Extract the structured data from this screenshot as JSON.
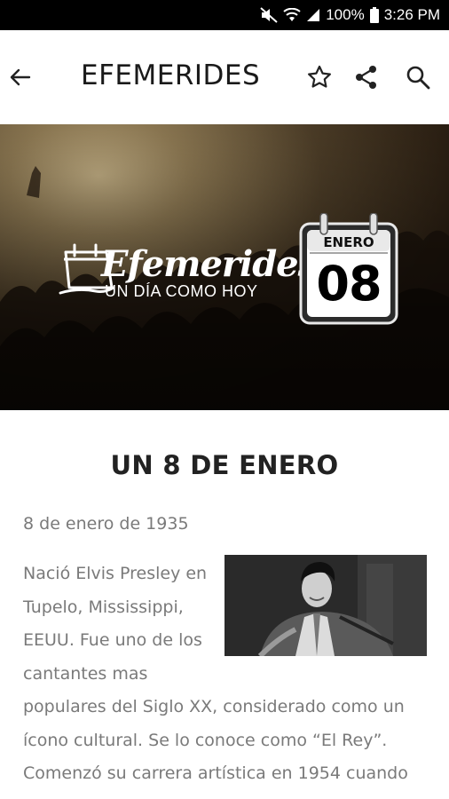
{
  "status_bar": {
    "battery": "100%",
    "time": "3:26 PM"
  },
  "app_bar": {
    "title": "EFEMERIDES",
    "icons": [
      "back-arrow-icon",
      "star-icon",
      "share-icon",
      "search-icon"
    ]
  },
  "banner": {
    "logo_title": "Efemerides",
    "logo_subtitle": "UN DÍA COMO HOY",
    "calendar_month": "ENERO",
    "calendar_day": "08"
  },
  "article": {
    "heading": "UN 8 DE ENERO",
    "date": "8 de enero de 1935",
    "body": "Nació Elvis Presley en Tupelo, Mississippi, EEUU. Fue uno de los cantantes mas populares del Siglo XX, considerado como un ícono cultural. Se lo conoce como “El Rey”. Comenzó su carrera artística en 1954 cuando Sam Phillips, el dueño"
  }
}
